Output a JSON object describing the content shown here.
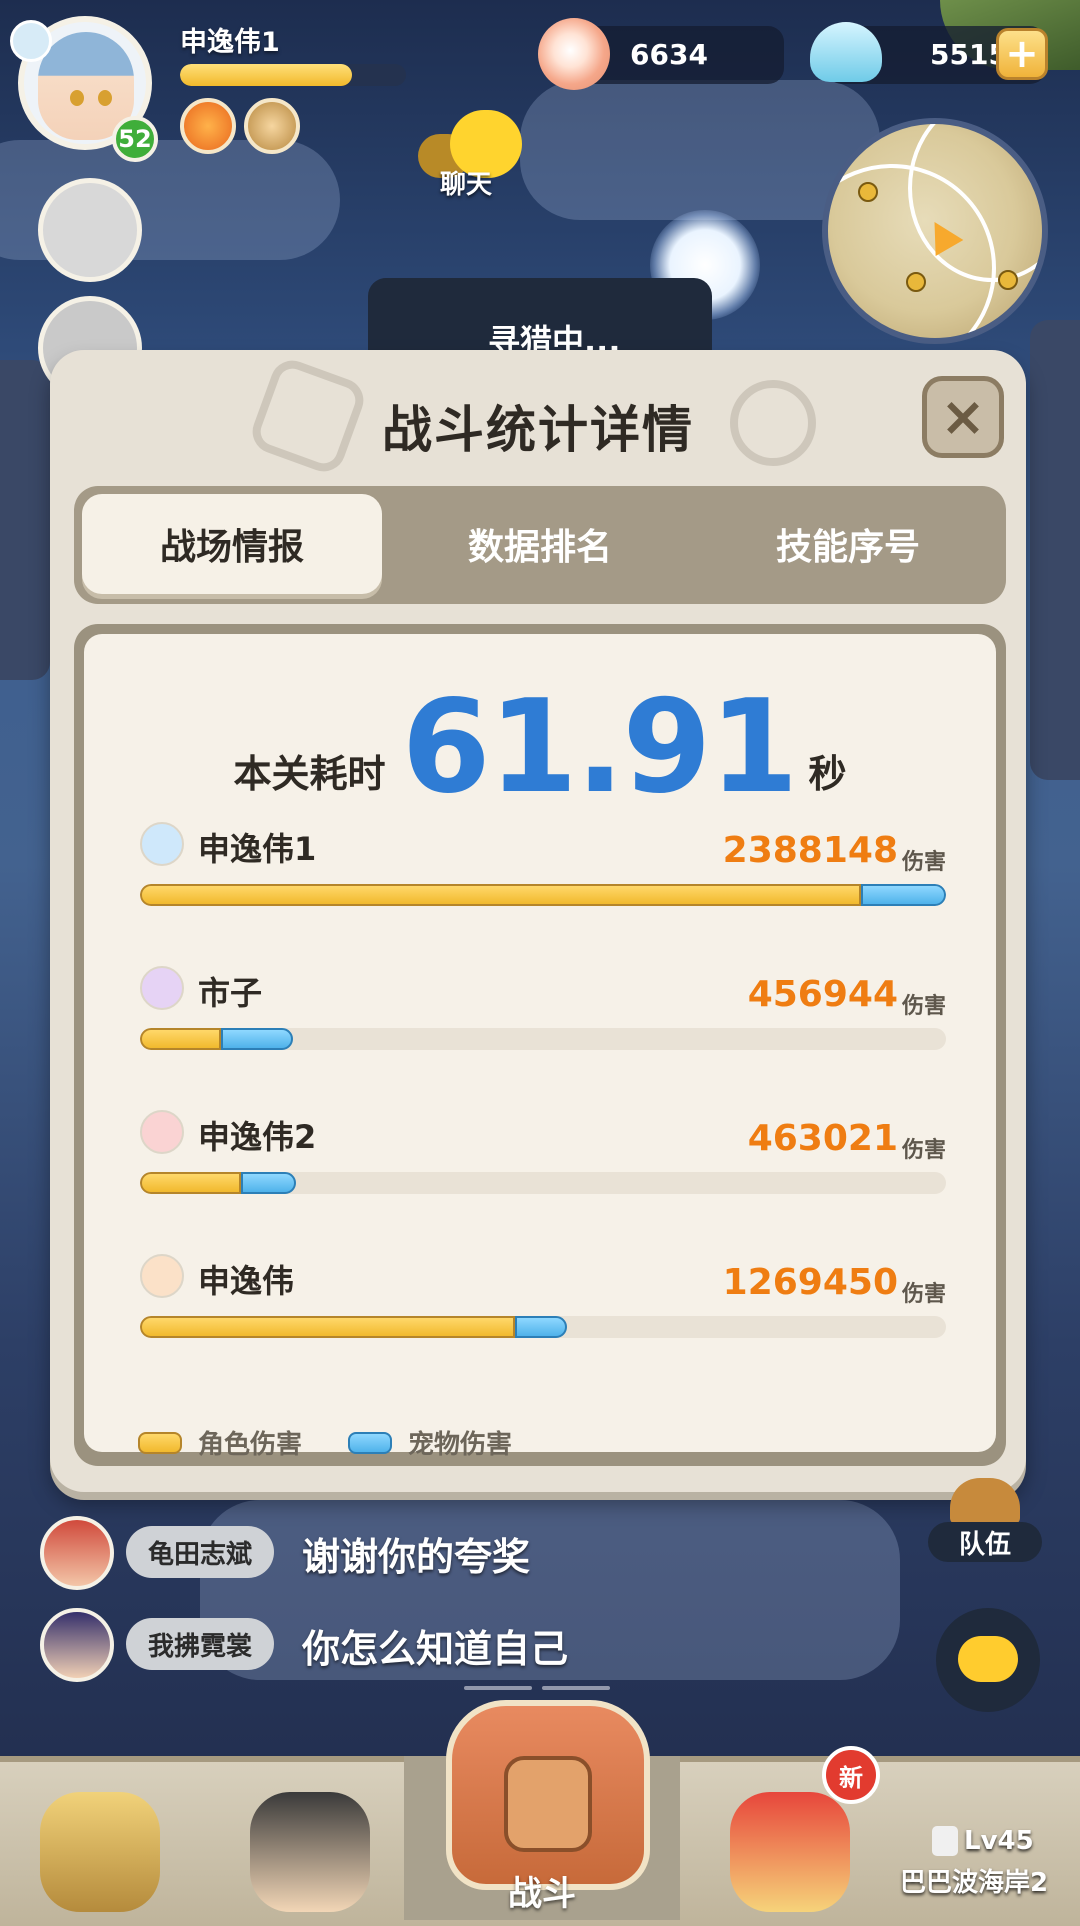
{
  "player": {
    "name": "申逸伟1",
    "level": "52",
    "exp_fraction": 0.76
  },
  "chat_label": "聊天",
  "currency": {
    "pearl": "6634",
    "shell": "55153"
  },
  "hunt_status": "寻猎中...",
  "modal": {
    "title": "战斗统计详情",
    "tabs": [
      {
        "label": "战场情报",
        "active": true
      },
      {
        "label": "数据排名",
        "active": false
      },
      {
        "label": "技能序号",
        "active": false
      }
    ],
    "time_label": "本关耗时",
    "time_value": "61.91",
    "time_unit": "秒",
    "damage_unit": "伤害",
    "stats": [
      {
        "name": "申逸伟1",
        "damage": "2388148",
        "role_fraction": 0.895,
        "pet_fraction": 0.105,
        "icon": "sword-icon",
        "color": "#cfe8fb"
      },
      {
        "name": "市子",
        "damage": "456944",
        "role_fraction": 0.1,
        "pet_fraction": 0.09,
        "icon": "orb-icon",
        "color": "#e6d3f5"
      },
      {
        "name": "申逸伟2",
        "damage": "463021",
        "role_fraction": 0.125,
        "pet_fraction": 0.068,
        "icon": "target-icon",
        "color": "#fad3d3"
      },
      {
        "name": "申逸伟",
        "damage": "1269450",
        "role_fraction": 0.465,
        "pet_fraction": 0.065,
        "icon": "flame-icon",
        "color": "#fbe1c8"
      }
    ],
    "legend": {
      "role": "角色伤害",
      "pet": "宠物伤害"
    },
    "colors": {
      "role": "#f1b92d",
      "pet": "#4fb2ea",
      "time": "#2f7cd4",
      "damage": "#ef7d12"
    }
  },
  "chat_feed": [
    {
      "user": "龟田志斌",
      "message": "谢谢你的夸奖"
    },
    {
      "user": "我拂霓裳",
      "message": "你怎么知道自己"
    }
  ],
  "team_label": "队伍",
  "nav": {
    "battle_label": "战斗",
    "new_badge": "新",
    "lock_level": "Lv45",
    "lock_location": "巴巴波海岸2"
  }
}
